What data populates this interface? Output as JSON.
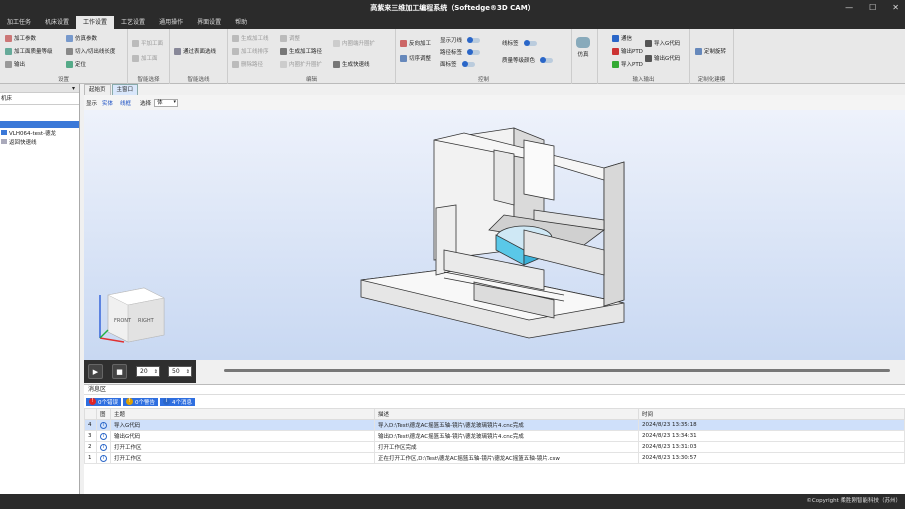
{
  "window": {
    "title": "高紫来三维加工编程系统（Softedge®3D CAM）",
    "min": "—",
    "max": "☐",
    "close": "✕"
  },
  "menu": [
    "加工任务",
    "机床设置",
    "工作设置",
    "工艺设置",
    "通用操作",
    "界面设置",
    "帮助"
  ],
  "ribbon": {
    "groups": [
      "设置",
      "智能选择",
      "智能选线",
      "编辑",
      "控制",
      "输入输出",
      "定制化建模"
    ],
    "setup": [
      "加工参数",
      "加工面质量等级",
      "输出",
      "仿真参数",
      "切入/切出线长度",
      "定位"
    ],
    "select": [
      "平加工面",
      "加工面"
    ],
    "selline": [
      "通过表面选线"
    ],
    "edit": [
      "生成加工线",
      "加工线排序",
      "删除路径",
      "调整",
      "生成加工路径",
      "生成快速线",
      "内圈端升圈扩",
      "内圈扩升圈扩"
    ],
    "control_a": [
      "反向加工",
      "切序调整"
    ],
    "control_b": [
      "显示刀线",
      "路径标签",
      "面标签"
    ],
    "control_c": [
      "线标签",
      "质量等级颜色"
    ],
    "sim": "仿真",
    "io_a": [
      "通信",
      "输出PTD",
      "导入PTD"
    ],
    "io_b": [
      "导入G代码",
      "输出G代码"
    ],
    "custom": [
      "定制旋转"
    ]
  },
  "left": {
    "pin": "▾",
    "tab": "机床",
    "tree": [
      "VLH064-test-德龙",
      "返回快速线"
    ]
  },
  "tabs": [
    "起始页",
    "主窗口"
  ],
  "viewbar": {
    "display": "显示",
    "solid": "实体",
    "wire": "线框",
    "select": "选择",
    "select_value": "体"
  },
  "viewcube": {
    "front": "FRONT",
    "right": "RIGHT"
  },
  "player": {
    "play": "▶",
    "stop": "■",
    "speed": "20",
    "step": "50"
  },
  "messages": {
    "title": "消息区",
    "filters": [
      {
        "label": "0个错误",
        "color": "#e02424"
      },
      {
        "label": "0个警告",
        "color": "#e0a000"
      },
      {
        "label": "4个消息",
        "color": "#2a66c8"
      }
    ],
    "columns": [
      "",
      "图",
      "主题",
      "描述",
      "时间"
    ],
    "rows": [
      {
        "no": "4",
        "subject": "导入G代码",
        "desc": "导入D:\\Test\\德龙AC摇篮五轴-镜片\\德龙玻璃镜片4.cnc完成",
        "time": "2024/8/23 13:35:18"
      },
      {
        "no": "3",
        "subject": "输出G代码",
        "desc": "输出D:\\Test\\德龙AC摇篮五轴-镜片\\德龙玻璃镜片4.cnc完成",
        "time": "2024/8/23 13:34:31"
      },
      {
        "no": "2",
        "subject": "打开工作区",
        "desc": "打开工作区完成",
        "time": "2024/8/23 13:31:03"
      },
      {
        "no": "1",
        "subject": "打开工作区",
        "desc": "正在打开工作区,D:\\Test\\德龙AC摇篮五轴-镜片\\德龙AC摇篮五轴-镜片.csw",
        "time": "2024/8/23 13:30:57"
      }
    ]
  },
  "status": "©Copyright 柔胜刚智能科技（苏州）",
  "colors": {
    "accent": "#2f6fe0",
    "chrome": "#2b2b2b"
  }
}
